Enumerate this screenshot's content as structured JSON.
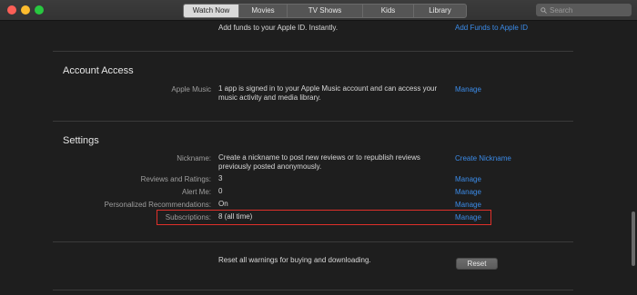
{
  "window": {
    "tabs": [
      {
        "label": "Watch Now",
        "active": true
      },
      {
        "label": "Movies",
        "active": false
      },
      {
        "label": "TV Shows",
        "active": false
      },
      {
        "label": "Kids",
        "active": false
      },
      {
        "label": "Library",
        "active": false
      }
    ],
    "search_placeholder": "Search"
  },
  "top_row": {
    "value": "Add funds to your Apple ID. Instantly.",
    "link": "Add Funds to Apple ID"
  },
  "account_access": {
    "title": "Account Access",
    "rows": [
      {
        "label": "Apple Music",
        "value_line1": "1 app is signed in to your Apple Music account and can access your",
        "value_line2": "music activity and media library.",
        "link": "Manage"
      }
    ]
  },
  "settings": {
    "title": "Settings",
    "rows": [
      {
        "label": "Nickname:",
        "value_line1": "Create a nickname to post new reviews or to republish reviews",
        "value_line2": "previously posted anonymously.",
        "link": "Create Nickname"
      },
      {
        "label": "Reviews and Ratings:",
        "value": "3",
        "link": "Manage"
      },
      {
        "label": "Alert Me:",
        "value": "0",
        "link": "Manage"
      },
      {
        "label": "Personalized Recommendations:",
        "value": "On",
        "link": "Manage"
      },
      {
        "label": "Subscriptions:",
        "value": "8 (all time)",
        "link": "Manage"
      }
    ]
  },
  "reset": {
    "text": "Reset all warnings for buying and downloading.",
    "button": "Reset"
  },
  "colors": {
    "background": "#1e1e1e",
    "link": "#3b8be8",
    "highlight_border": "#e0302a"
  }
}
